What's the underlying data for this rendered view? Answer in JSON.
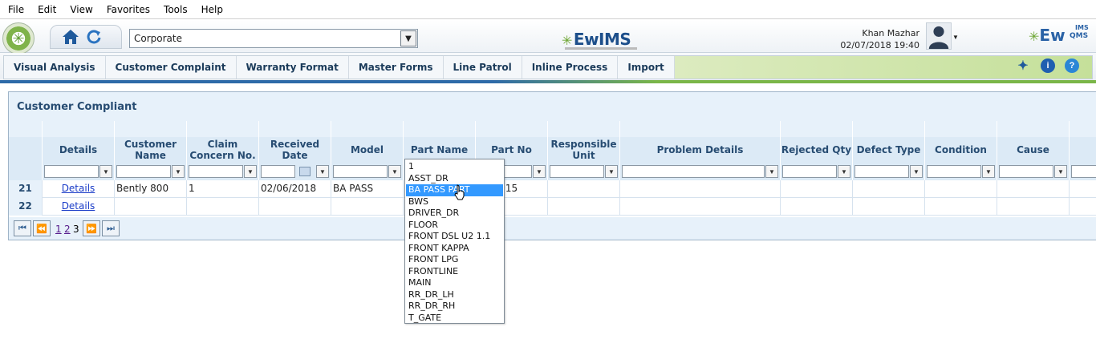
{
  "menubar": [
    "File",
    "Edit",
    "View",
    "Favorites",
    "Tools",
    "Help"
  ],
  "header": {
    "location": "Corporate",
    "brand_center": "EwIMS",
    "user_name": "Khan Mazhar",
    "datetime": "02/07/2018 19:40",
    "brand_right": "Ew",
    "brand_right_sup": "IMS",
    "brand_right_sub": "QMS"
  },
  "modules": [
    "Visual Analysis",
    "Customer Complaint",
    "Warranty Format",
    "Master Forms",
    "Line Patrol",
    "Inline Process",
    "Import"
  ],
  "panel": {
    "title": "Customer Compliant",
    "columns": [
      "Details",
      "Customer Name",
      "Claim Concern No.",
      "Received Date",
      "Model",
      "Part Name",
      "Part No",
      "Responsible Unit",
      "Problem Details",
      "Rejected Qty",
      "Defect Type",
      "Condition",
      "Cause"
    ],
    "rows": [
      {
        "num": "21",
        "details": "Details",
        "customer": "Bently 800",
        "claim": "1",
        "date": "02/06/2018",
        "model": "BA PASS",
        "part_no": "16-2015"
      },
      {
        "num": "22",
        "details": "Details",
        "customer": "",
        "claim": "",
        "date": "",
        "model": "",
        "part_no": ""
      }
    ],
    "pages": [
      "1",
      "2",
      "3"
    ],
    "current_page": "3"
  },
  "dropdown": {
    "options": [
      "1",
      "ASST_DR",
      "BA PASS PART",
      "BWS",
      "DRIVER_DR",
      "FLOOR",
      "FRONT DSL U2 1.1",
      "FRONT KAPPA",
      "FRONT LPG",
      "FRONTLINE",
      "MAIN",
      "RR_DR_LH",
      "RR_DR_RH",
      "T_GATE"
    ],
    "highlighted": "BA PASS PART"
  },
  "colors": {
    "accent": "#274c72",
    "highlight": "#3399ff",
    "green": "#7ab648"
  }
}
